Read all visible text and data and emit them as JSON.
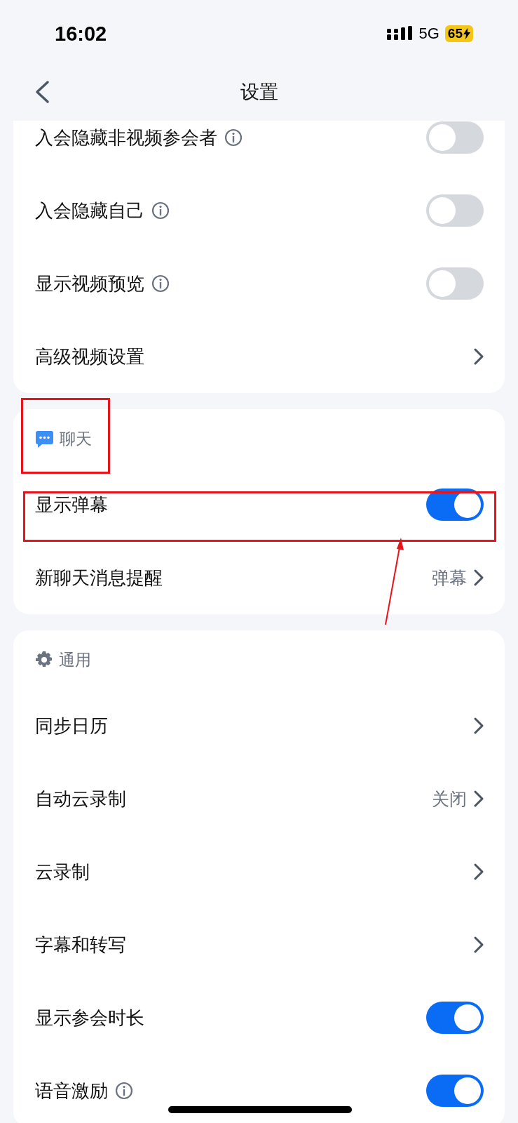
{
  "status_bar": {
    "time": "16:02",
    "network": "5G",
    "battery": "65"
  },
  "nav": {
    "title": "设置"
  },
  "sections": [
    {
      "rows": [
        {
          "kind": "toggle",
          "label": "入会隐藏非视频参会者",
          "info": true,
          "on": false
        },
        {
          "kind": "toggle",
          "label": "入会隐藏自己",
          "info": true,
          "on": false
        },
        {
          "kind": "toggle",
          "label": "显示视频预览",
          "info": true,
          "on": false
        },
        {
          "kind": "link",
          "label": "高级视频设置",
          "info": false
        }
      ]
    },
    {
      "header": {
        "kind": "chat",
        "title": "聊天",
        "annotated": true
      },
      "rows": [
        {
          "kind": "toggle",
          "label": "显示弹幕",
          "info": false,
          "on": true,
          "annotated": true
        },
        {
          "kind": "link",
          "label": "新聊天消息提醒",
          "info": false,
          "value": "弹幕"
        }
      ]
    },
    {
      "header": {
        "kind": "gear",
        "title": "通用"
      },
      "rows": [
        {
          "kind": "link",
          "label": "同步日历",
          "info": false
        },
        {
          "kind": "link",
          "label": "自动云录制",
          "info": false,
          "value": "关闭"
        },
        {
          "kind": "link",
          "label": "云录制",
          "info": false
        },
        {
          "kind": "link",
          "label": "字幕和转写",
          "info": false
        },
        {
          "kind": "toggle",
          "label": "显示参会时长",
          "info": false,
          "on": true
        },
        {
          "kind": "toggle",
          "label": "语音激励",
          "info": true,
          "on": true
        }
      ]
    }
  ]
}
